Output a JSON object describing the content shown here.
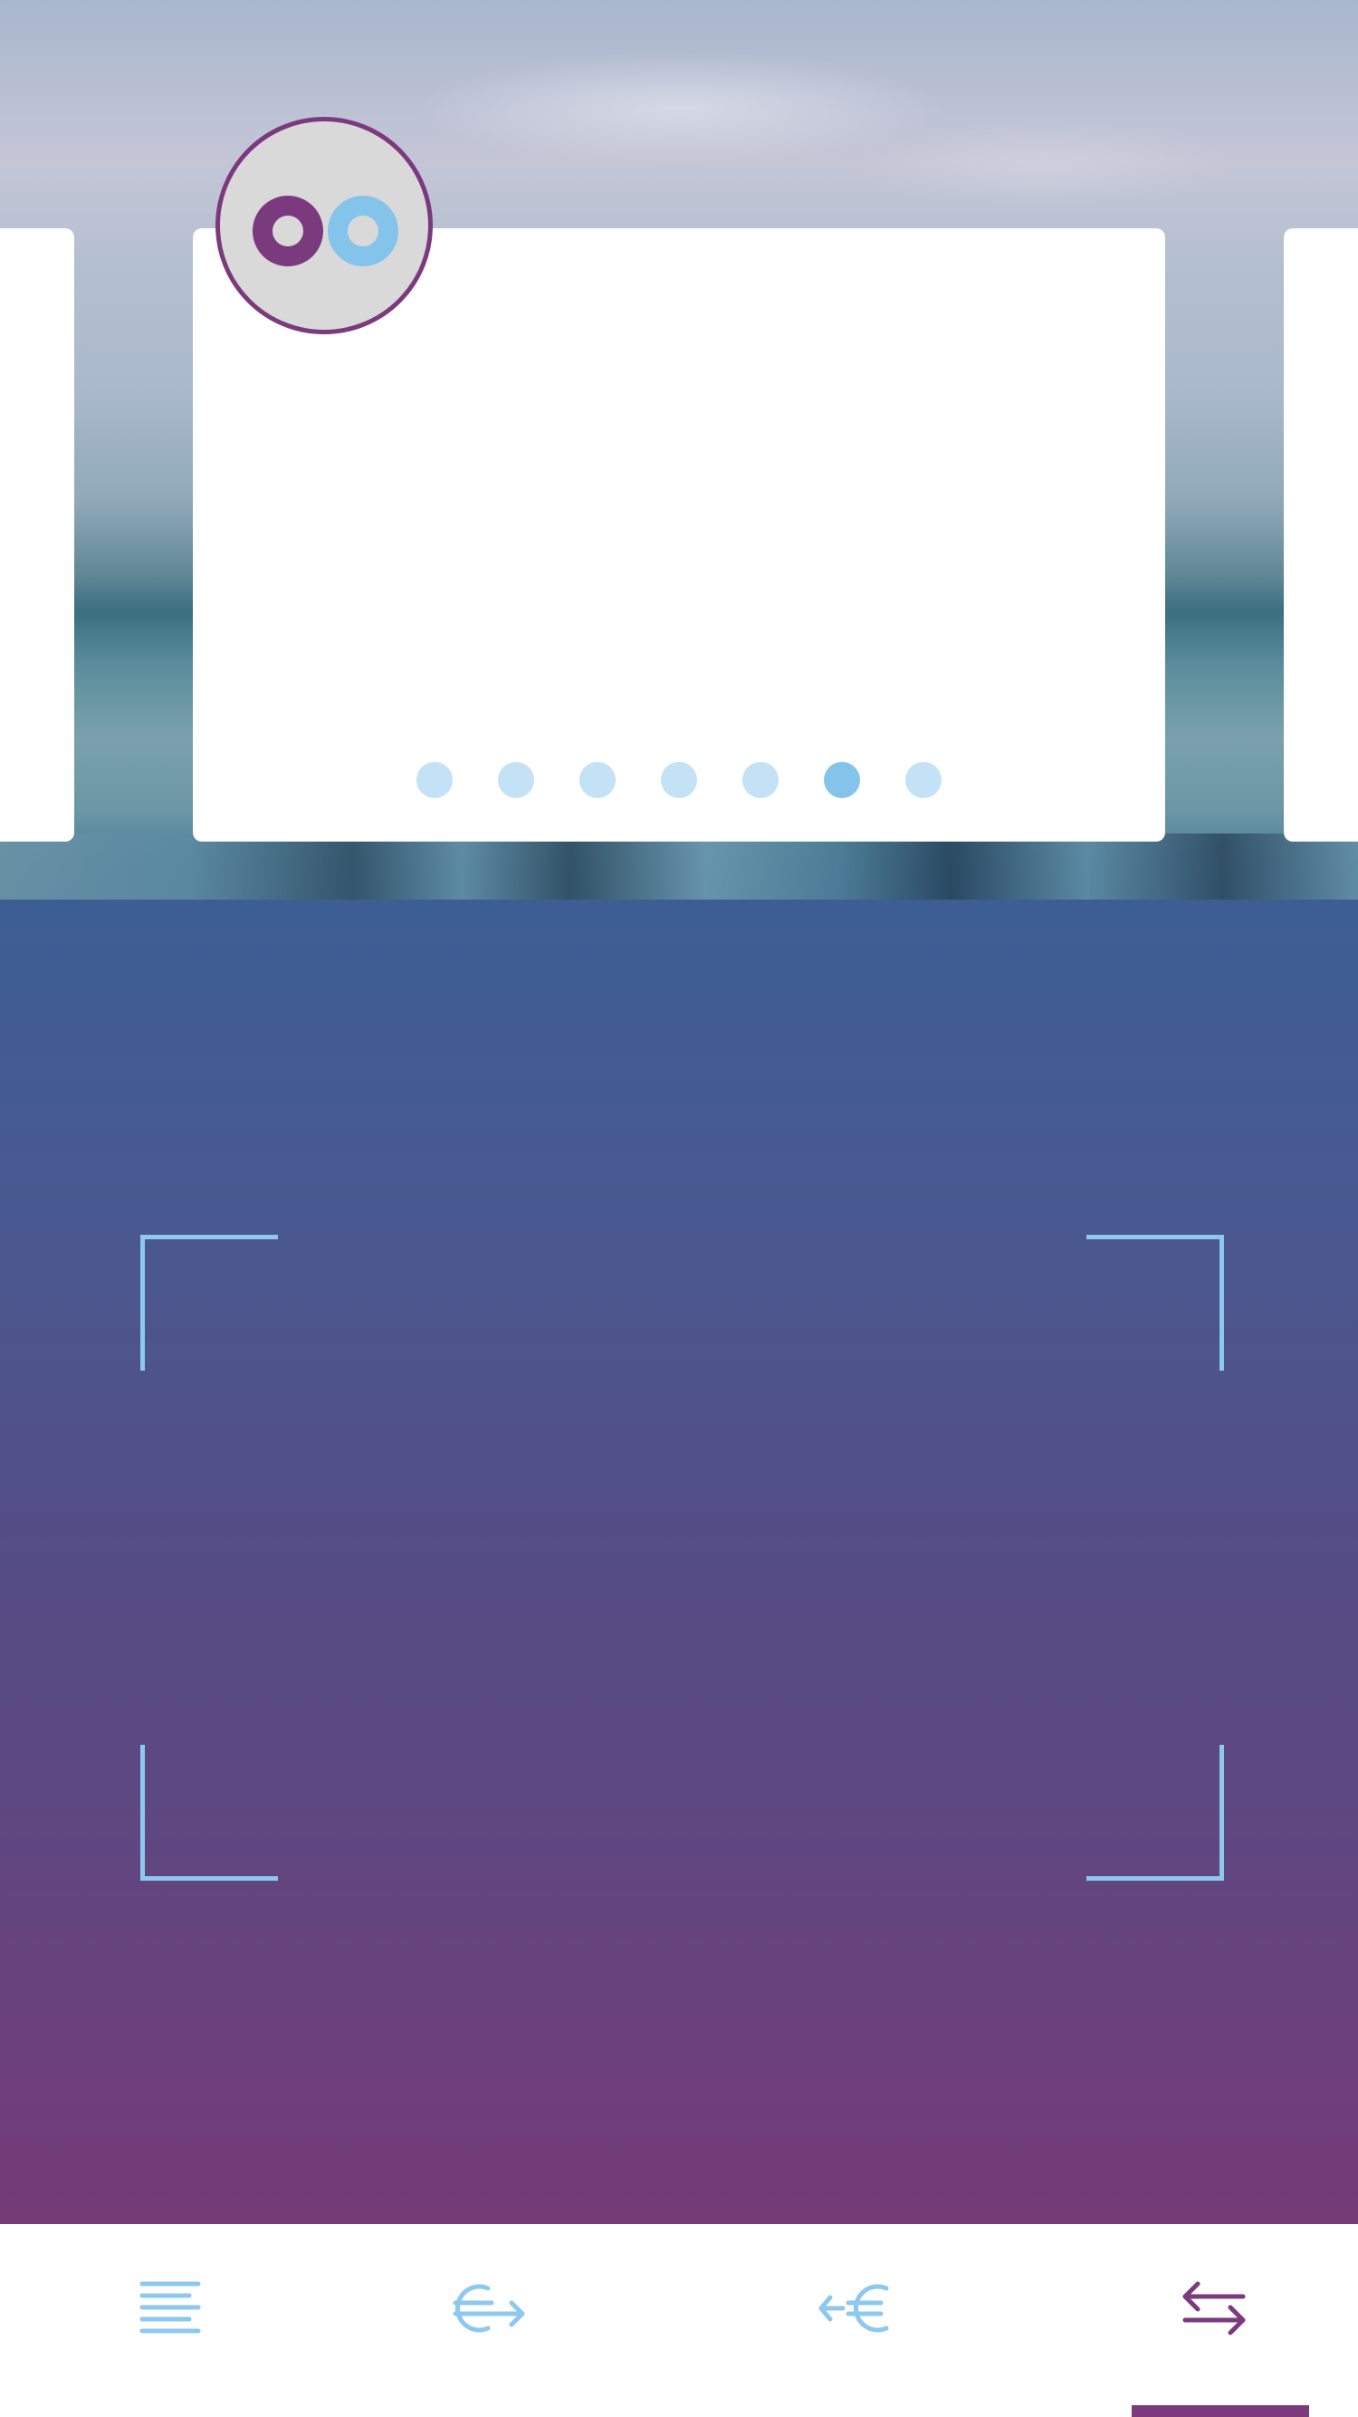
{
  "colors": {
    "brand_purple": "#7b3a7e",
    "brand_light_blue": "#85c4ea",
    "dot_inactive": "#c3e2f6",
    "scanner_top": "#3c5e94",
    "scanner_bottom": "#743a76",
    "tab_active": "#7b3a7e",
    "tab_inactive": "#8cc8f0"
  },
  "logo": {
    "icon": "oo-logo"
  },
  "carousel": {
    "page_count": 7,
    "active_index": 5
  },
  "tabbar": {
    "items": [
      {
        "icon": "list-icon",
        "active": false
      },
      {
        "icon": "euro-send-icon",
        "active": false
      },
      {
        "icon": "euro-receive-icon",
        "active": false
      },
      {
        "icon": "exchange-arrows-icon",
        "active": true
      }
    ]
  }
}
